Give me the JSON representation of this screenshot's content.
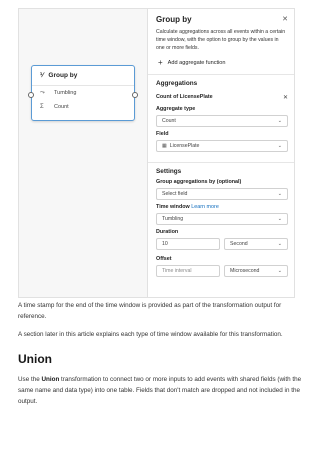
{
  "node": {
    "title": "Group by",
    "rows": [
      "Tumbling",
      "Count"
    ]
  },
  "panel": {
    "title": "Group by",
    "description": "Calculate aggregations across all events within a certain time window, with the option to group by the values in one or more fields.",
    "add_label": "Add aggregate function",
    "aggregations_title": "Aggregations",
    "aggregation_item": "Count of LicensePlate",
    "aggregate_type_label": "Aggregate type",
    "aggregate_type_value": "Count",
    "field_label": "Field",
    "field_value": "LicensePlate",
    "settings_title": "Settings",
    "group_label": "Group aggregations by (optional)",
    "group_value": "Select field",
    "time_window_label": "Time window",
    "learn_more": "Learn more",
    "time_window_value": "Tumbling",
    "duration_label": "Duration",
    "duration_value": "10",
    "duration_unit": "Second",
    "offset_label": "Offset",
    "offset_placeholder": "Time interval",
    "offset_unit": "Microsecond"
  },
  "article": {
    "para1": "A time stamp for the end of the time window is provided as part of the transformation output for reference.",
    "para2": "A section later in this article explains each type of time window available for this transformation.",
    "heading": "Union",
    "para3_pre": "Use the ",
    "para3_bold": "Union",
    "para3_post": " transformation to connect two or more inputs to add events with shared fields (with the same name and data type) into one table. Fields that don't match are dropped and not included in the output."
  },
  "icons": {
    "node_icon": "group-by-icon",
    "tumbling_icon": "tumbling-window-icon",
    "count_icon": "sigma-icon",
    "table_icon": "table-icon"
  }
}
